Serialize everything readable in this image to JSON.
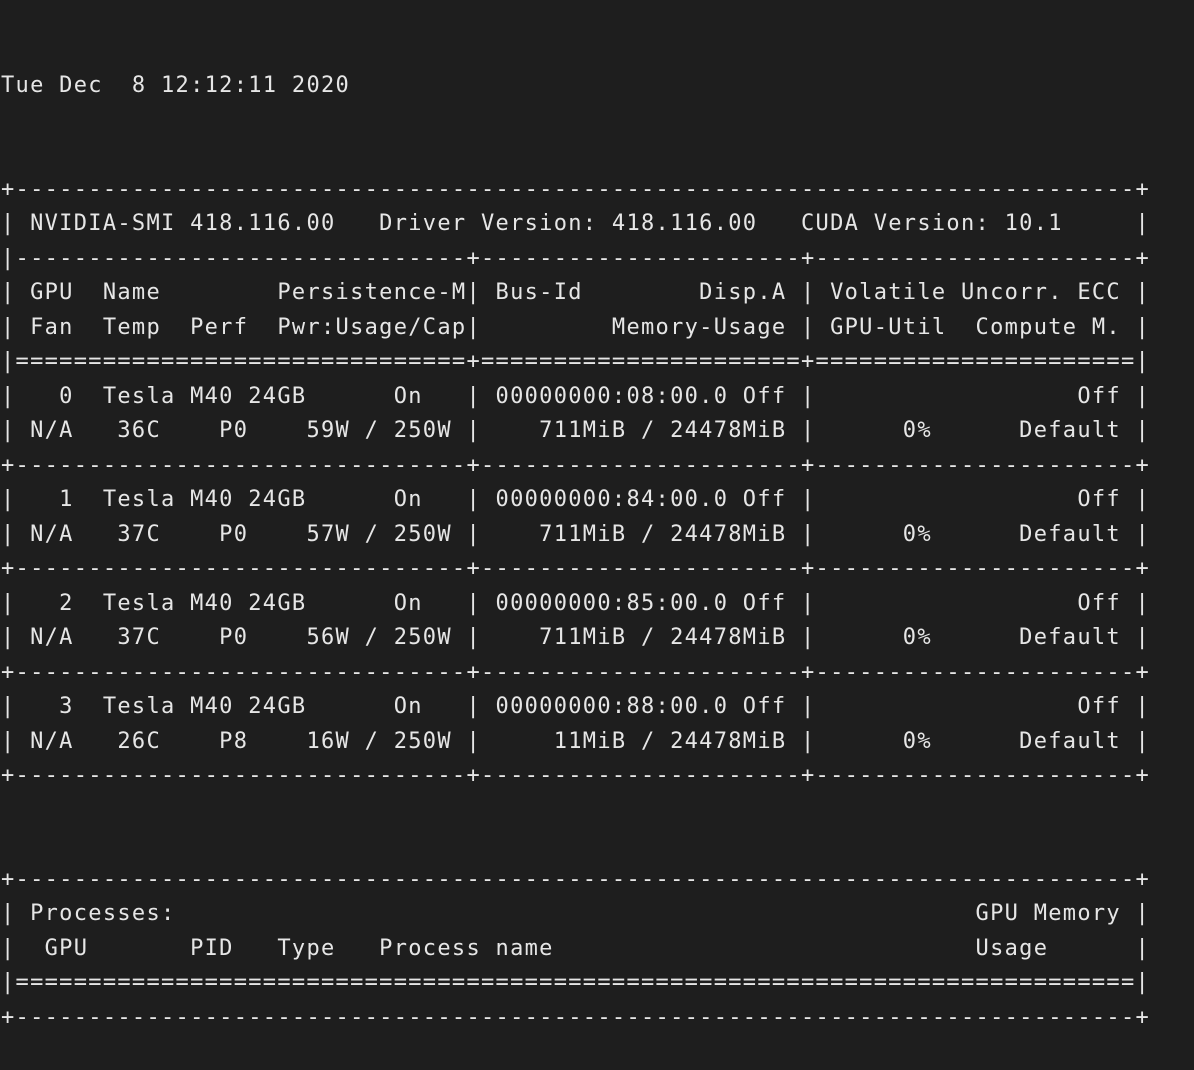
{
  "terminal": {
    "timestamp": "Tue Dec  8 12:12:11 2020",
    "lines": [
      "+-----------------------------------------------------------------------------+",
      "| NVIDIA-SMI 418.116.00   Driver Version: 418.116.00   CUDA Version: 10.1     |",
      "|-------------------------------+----------------------+----------------------+",
      "| GPU  Name        Persistence-M| Bus-Id        Disp.A | Volatile Uncorr. ECC |",
      "| Fan  Temp  Perf  Pwr:Usage/Cap|         Memory-Usage | GPU-Util  Compute M. |",
      "|===============================+======================+======================|",
      "|   0  Tesla M40 24GB      On   | 00000000:08:00.0 Off |                  Off |",
      "| N/A   36C    P0    59W / 250W |    711MiB / 24478MiB |      0%      Default |",
      "+-------------------------------+----------------------+----------------------+",
      "|   1  Tesla M40 24GB      On   | 00000000:84:00.0 Off |                  Off |",
      "| N/A   37C    P0    57W / 250W |    711MiB / 24478MiB |      0%      Default |",
      "+-------------------------------+----------------------+----------------------+",
      "|   2  Tesla M40 24GB      On   | 00000000:85:00.0 Off |                  Off |",
      "| N/A   37C    P0    56W / 250W |    711MiB / 24478MiB |      0%      Default |",
      "+-------------------------------+----------------------+----------------------+",
      "|   3  Tesla M40 24GB      On   | 00000000:88:00.0 Off |                  Off |",
      "| N/A   26C    P8    16W / 250W |     11MiB / 24478MiB |      0%      Default |",
      "+-------------------------------+----------------------+----------------------+",
      "",
      "",
      "+-----------------------------------------------------------------------------+",
      "| Processes:                                                       GPU Memory |",
      "|  GPU       PID   Type   Process name                             Usage      |",
      "|=============================================================================|",
      "+-----------------------------------------------------------------------------+"
    ]
  }
}
